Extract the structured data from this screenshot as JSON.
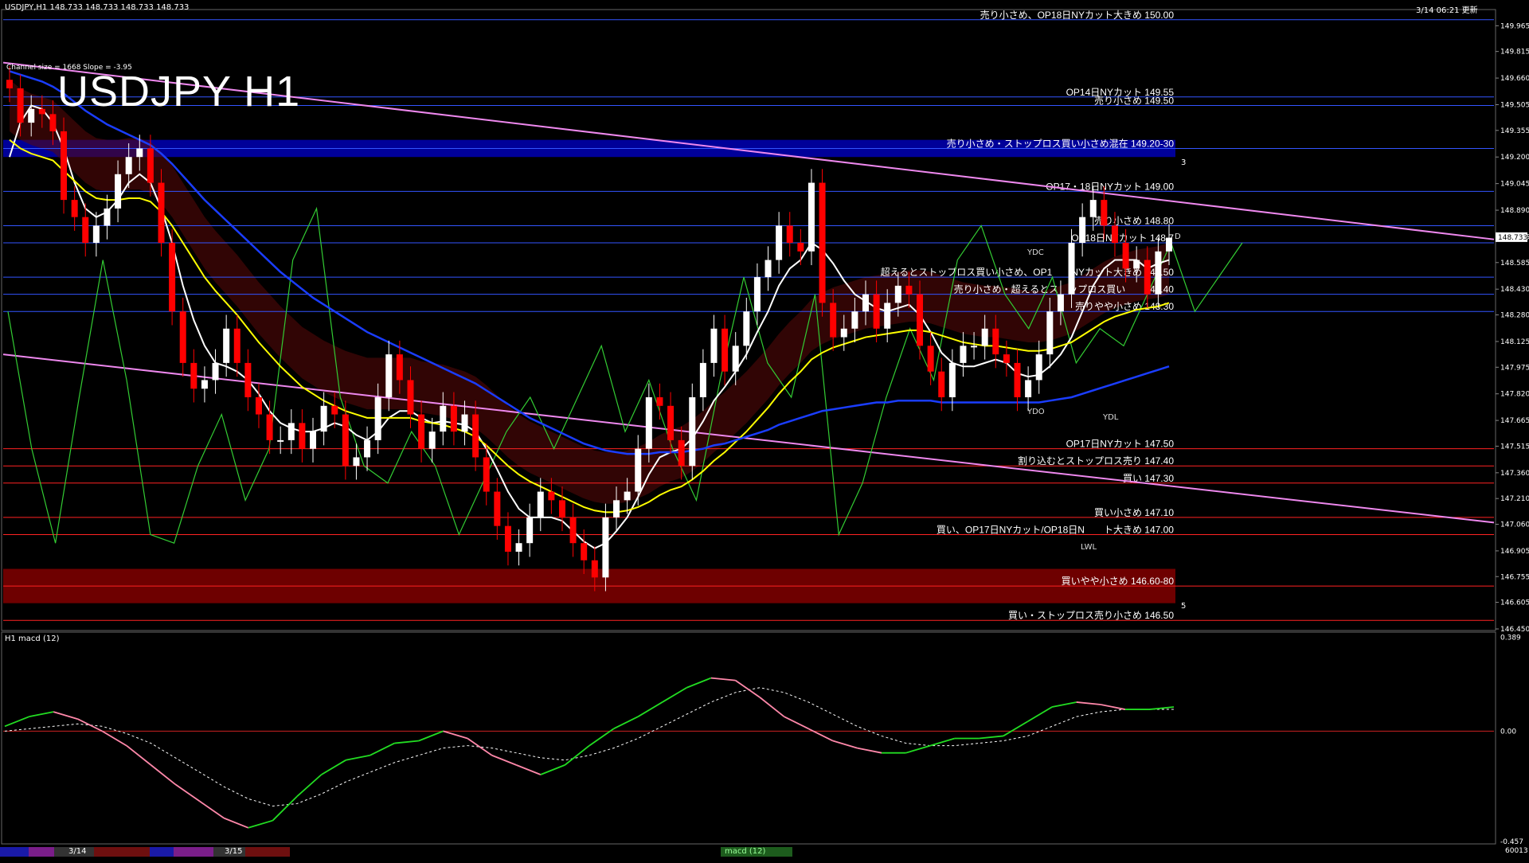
{
  "header": {
    "symbol_line": "USDJPY,H1  148.733 148.733 148.733 148.733",
    "update_time": "3/14 06:21 更新",
    "channel_info": "Channel size = 1668 Slope = -3.95",
    "big_title": "USDJPY H1",
    "sub_label": "H1 macd (12)",
    "bottom_code": "60013"
  },
  "colors": {
    "background": "#000000",
    "bull_candle": "#ffffff",
    "bear_candle": "#ff0000",
    "ma_white": "#ffffff",
    "ma_yellow": "#ffff00",
    "ma_blue": "#1a3dff",
    "chikou_green": "#33cc33",
    "channel_pink": "#ee88ee",
    "level_blue": "#3355ff",
    "level_red": "#ff2222",
    "zone_blue": "#0000aa",
    "zone_red": "#7a0000",
    "macd_green": "#22dd22",
    "macd_pink": "#ff88aa"
  },
  "chart_data": [
    {
      "type": "line",
      "title": "USDJPY H1",
      "ylim": [
        146.45,
        150.05
      ],
      "y_ticks": [
        "149.965",
        "149.815",
        "149.660",
        "149.505",
        "149.355",
        "149.200",
        "149.045",
        "148.890",
        "148.735",
        "148.585",
        "148.430",
        "148.280",
        "148.125",
        "147.975",
        "147.820",
        "147.665",
        "147.515",
        "147.360",
        "147.210",
        "147.060",
        "146.905",
        "146.755",
        "146.605",
        "146.450"
      ],
      "current_price": "148.733",
      "price_series": {
        "name": "",
        "values": [
          149.6,
          149.4,
          149.48,
          149.45,
          149.35,
          148.95,
          148.85,
          148.7,
          148.8,
          148.9,
          149.1,
          149.2,
          149.25,
          149.05,
          148.7,
          148.3,
          148.0,
          147.85,
          147.9,
          148.0,
          148.2,
          148.0,
          147.8,
          147.7,
          147.55,
          147.55,
          147.65,
          147.5,
          147.6,
          147.75,
          147.7,
          147.4,
          147.45,
          147.55,
          147.8,
          148.05,
          147.9,
          147.7,
          147.5,
          147.6,
          147.75,
          147.6,
          147.7,
          147.45,
          147.25,
          147.05,
          146.9,
          146.95,
          147.1,
          147.25,
          147.2,
          147.1,
          146.95,
          146.85,
          146.75,
          147.1,
          147.2,
          147.25,
          147.5,
          147.8,
          147.75,
          147.55,
          147.4,
          147.8,
          148.0,
          148.2,
          147.95,
          148.1,
          148.3,
          148.5,
          148.6,
          148.8,
          148.7,
          148.65,
          149.05,
          148.35,
          148.15,
          148.2,
          148.3,
          148.4,
          148.2,
          148.35,
          148.45,
          148.4,
          148.1,
          147.95,
          147.8,
          148.0,
          148.1,
          148.1,
          148.2,
          148.05,
          148.0,
          147.8,
          147.9,
          148.05,
          148.3,
          148.4,
          148.7,
          148.85,
          148.95,
          148.8,
          148.7,
          148.55,
          148.6,
          148.4,
          148.65,
          148.73
        ]
      },
      "moving_averages": [
        {
          "name": "",
          "color": "#ffffff",
          "values": [
            149.2,
            149.4,
            149.5,
            149.48,
            149.4,
            149.25,
            149.05,
            148.9,
            148.85,
            148.88,
            148.95,
            149.05,
            149.1,
            149.05,
            148.9,
            148.7,
            148.45,
            148.25,
            148.1,
            148.0,
            147.98,
            147.95,
            147.9,
            147.82,
            147.72,
            147.65,
            147.62,
            147.6,
            147.6,
            147.62,
            147.65,
            147.63,
            147.58,
            147.55,
            147.6,
            147.68,
            147.72,
            147.72,
            147.68,
            147.65,
            147.66,
            147.65,
            147.64,
            147.6,
            147.5,
            147.38,
            147.25,
            147.15,
            147.1,
            147.1,
            147.1,
            147.08,
            147.02,
            146.96,
            146.92,
            146.95,
            147.02,
            147.1,
            147.22,
            147.35,
            147.45,
            147.48,
            147.5,
            147.56,
            147.66,
            147.78,
            147.86,
            147.95,
            148.05,
            148.18,
            148.3,
            148.45,
            148.55,
            148.6,
            148.7,
            148.66,
            148.58,
            148.48,
            148.4,
            148.36,
            148.32,
            148.3,
            148.32,
            148.34,
            148.28,
            148.18,
            148.06,
            148.0,
            147.98,
            147.98,
            148.0,
            148.02,
            148.0,
            147.94,
            147.92,
            147.93,
            147.98,
            148.05,
            148.15,
            148.3,
            148.45,
            148.55,
            148.6,
            148.6,
            148.6,
            148.55,
            148.58,
            148.6
          ]
        },
        {
          "name": "",
          "color": "#ffff00",
          "values": [
            149.3,
            149.25,
            149.22,
            149.2,
            149.18,
            149.12,
            149.06,
            149.0,
            148.96,
            148.95,
            148.95,
            148.96,
            148.96,
            148.94,
            148.88,
            148.8,
            148.7,
            148.6,
            148.5,
            148.42,
            148.35,
            148.28,
            148.2,
            148.12,
            148.05,
            147.98,
            147.92,
            147.86,
            147.82,
            147.78,
            147.75,
            147.72,
            147.7,
            147.68,
            147.68,
            147.68,
            147.68,
            147.68,
            147.66,
            147.65,
            147.64,
            147.62,
            147.6,
            147.57,
            147.52,
            147.46,
            147.4,
            147.35,
            147.31,
            147.28,
            147.25,
            147.22,
            147.19,
            147.16,
            147.14,
            147.13,
            147.13,
            147.14,
            147.16,
            147.19,
            147.23,
            147.26,
            147.28,
            147.32,
            147.37,
            147.43,
            147.48,
            147.54,
            147.6,
            147.67,
            147.74,
            147.82,
            147.89,
            147.95,
            148.02,
            148.06,
            148.09,
            148.11,
            148.13,
            148.15,
            148.16,
            148.17,
            148.18,
            148.19,
            148.19,
            148.18,
            148.16,
            148.14,
            148.12,
            148.11,
            148.1,
            148.1,
            148.09,
            148.08,
            148.07,
            148.07,
            148.08,
            148.1,
            148.12,
            148.16,
            148.2,
            148.24,
            148.27,
            148.29,
            148.31,
            148.32,
            148.33,
            148.35
          ]
        },
        {
          "name": "",
          "color": "#1a3dff",
          "values": [
            149.7,
            149.68,
            149.66,
            149.64,
            149.61,
            149.57,
            149.52,
            149.47,
            149.43,
            149.39,
            149.36,
            149.33,
            149.3,
            149.27,
            149.22,
            149.16,
            149.09,
            149.02,
            148.95,
            148.89,
            148.83,
            148.77,
            148.71,
            148.65,
            148.59,
            148.53,
            148.48,
            148.43,
            148.38,
            148.34,
            148.3,
            148.26,
            148.22,
            148.18,
            148.15,
            148.12,
            148.09,
            148.06,
            148.03,
            148.0,
            147.97,
            147.94,
            147.91,
            147.88,
            147.84,
            147.8,
            147.76,
            147.72,
            147.68,
            147.65,
            147.62,
            147.59,
            147.56,
            147.53,
            147.51,
            147.49,
            147.48,
            147.47,
            147.47,
            147.47,
            147.48,
            147.48,
            147.48,
            147.49,
            147.5,
            147.52,
            147.53,
            147.55,
            147.57,
            147.59,
            147.61,
            147.64,
            147.66,
            147.68,
            147.7,
            147.72,
            147.73,
            147.74,
            147.75,
            147.76,
            147.77,
            147.77,
            147.78,
            147.78,
            147.78,
            147.78,
            147.77,
            147.77,
            147.77,
            147.77,
            147.77,
            147.77,
            147.77,
            147.77,
            147.77,
            147.77,
            147.78,
            147.79,
            147.8,
            147.82,
            147.84,
            147.86,
            147.88,
            147.9,
            147.92,
            147.94,
            147.96,
            147.98
          ]
        }
      ],
      "chikou_series": {
        "name": "",
        "color": "#33cc33",
        "values": [
          148.3,
          147.5,
          146.95,
          147.8,
          148.6,
          147.9,
          147.0,
          146.95,
          147.4,
          147.7,
          147.2,
          147.5,
          148.6,
          148.9,
          147.8,
          147.4,
          147.3,
          147.6,
          147.4,
          147.0,
          147.3,
          147.6,
          147.8,
          147.5,
          147.8,
          148.1,
          147.6,
          147.9,
          147.5,
          147.2,
          147.9,
          148.5,
          148.0,
          147.8,
          148.4,
          147.0,
          147.3,
          147.8,
          148.2,
          147.9,
          148.6,
          148.8,
          148.4,
          148.2,
          148.5,
          148.0,
          148.2,
          148.1,
          148.4,
          148.7,
          148.3,
          148.5,
          148.7
        ]
      },
      "price_levels": [
        {
          "price": "150.00",
          "label": "売り小さめ、OP18日NYカット大きめ 150.00",
          "color": "#3355ff"
        },
        {
          "price": "149.55",
          "label": "OP14日NYカット 149.55",
          "color": "#3355ff"
        },
        {
          "price": "149.50",
          "label": "売り小さめ 149.50",
          "color": "#3355ff"
        },
        {
          "price": "149.25",
          "label": "売り小さめ・ストップロス買い小さめ混在 149.20-30",
          "color": "#3355ff"
        },
        {
          "price": "149.00",
          "label": "OP17・18日NYカット 149.00",
          "color": "#3355ff"
        },
        {
          "price": "148.80",
          "label": "売り小さめ 148.80",
          "color": "#3355ff"
        },
        {
          "price": "148.70",
          "label": "OP18日NYカット 148.7",
          "color": "#3355ff"
        },
        {
          "price": "148.50",
          "label": "超えるとストップロス買い小さめ、OP1　　NYカット大きめ 148.50",
          "color": "#3355ff"
        },
        {
          "price": "148.40",
          "label": "売り小さめ・超えるとス　ップロス買い　　148.40",
          "color": "#3355ff"
        },
        {
          "price": "148.30",
          "label": "売りやや小さめ 148.30",
          "color": "#3355ff"
        },
        {
          "price": "147.50",
          "label": "OP17日NYカット 147.50",
          "color": "#ff2222"
        },
        {
          "price": "147.40",
          "label": "割り込むとストップロス売り 147.40",
          "color": "#ff2222"
        },
        {
          "price": "147.30",
          "label": "買い 147.30",
          "color": "#ff2222"
        },
        {
          "price": "147.10",
          "label": "買い小さめ 147.10",
          "color": "#ff2222"
        },
        {
          "price": "147.00",
          "label": "買い、OP17日NYカット/OP18日N　　ト大きめ 147.00",
          "color": "#ff2222"
        },
        {
          "price": "146.70",
          "label": "買いやや小さめ 146.60-80",
          "color": "#ff2222"
        },
        {
          "price": "146.50",
          "label": "買い・ストップロス売り小さめ 146.50",
          "color": "#ff2222"
        }
      ],
      "zones": [
        {
          "from": 149.2,
          "to": 149.3,
          "color": "#0000aa"
        },
        {
          "from": 146.6,
          "to": 146.8,
          "color": "#7a0000"
        }
      ],
      "markers": [
        "YDC",
        "YDO",
        "YDL",
        "LWL",
        "D",
        "3",
        "5"
      ]
    },
    {
      "type": "line",
      "title": "H1 macd (12)",
      "ylim": [
        -0.46,
        0.39
      ],
      "y_ticks": [
        "0.389",
        "0.00",
        "-0.457"
      ],
      "macd_line": {
        "name": "",
        "color": "#22dd22",
        "values": [
          0.02,
          0.06,
          0.08,
          0.05,
          0.0,
          -0.06,
          -0.14,
          -0.22,
          -0.29,
          -0.36,
          -0.4,
          -0.37,
          -0.27,
          -0.18,
          -0.12,
          -0.1,
          -0.05,
          -0.04,
          0.0,
          -0.03,
          -0.1,
          -0.14,
          -0.18,
          -0.14,
          -0.06,
          0.01,
          0.06,
          0.12,
          0.18,
          0.22,
          0.21,
          0.14,
          0.06,
          0.01,
          -0.04,
          -0.07,
          -0.09,
          -0.09,
          -0.06,
          -0.03,
          -0.03,
          -0.02,
          0.04,
          0.1,
          0.12,
          0.11,
          0.09,
          0.09,
          0.1
        ]
      },
      "signal_line": {
        "name": "",
        "color": "#ffffff",
        "values": [
          0.0,
          0.01,
          0.02,
          0.03,
          0.02,
          -0.01,
          -0.05,
          -0.11,
          -0.17,
          -0.23,
          -0.28,
          -0.31,
          -0.3,
          -0.26,
          -0.21,
          -0.17,
          -0.13,
          -0.1,
          -0.07,
          -0.06,
          -0.07,
          -0.09,
          -0.11,
          -0.12,
          -0.1,
          -0.07,
          -0.03,
          0.02,
          0.07,
          0.12,
          0.16,
          0.18,
          0.16,
          0.12,
          0.07,
          0.02,
          -0.02,
          -0.05,
          -0.06,
          -0.06,
          -0.05,
          -0.04,
          -0.02,
          0.02,
          0.06,
          0.08,
          0.09,
          0.09,
          0.09
        ]
      }
    }
  ],
  "taskbar": {
    "labels": [
      "3/14",
      "3/15"
    ],
    "tab": "macd (12)"
  }
}
